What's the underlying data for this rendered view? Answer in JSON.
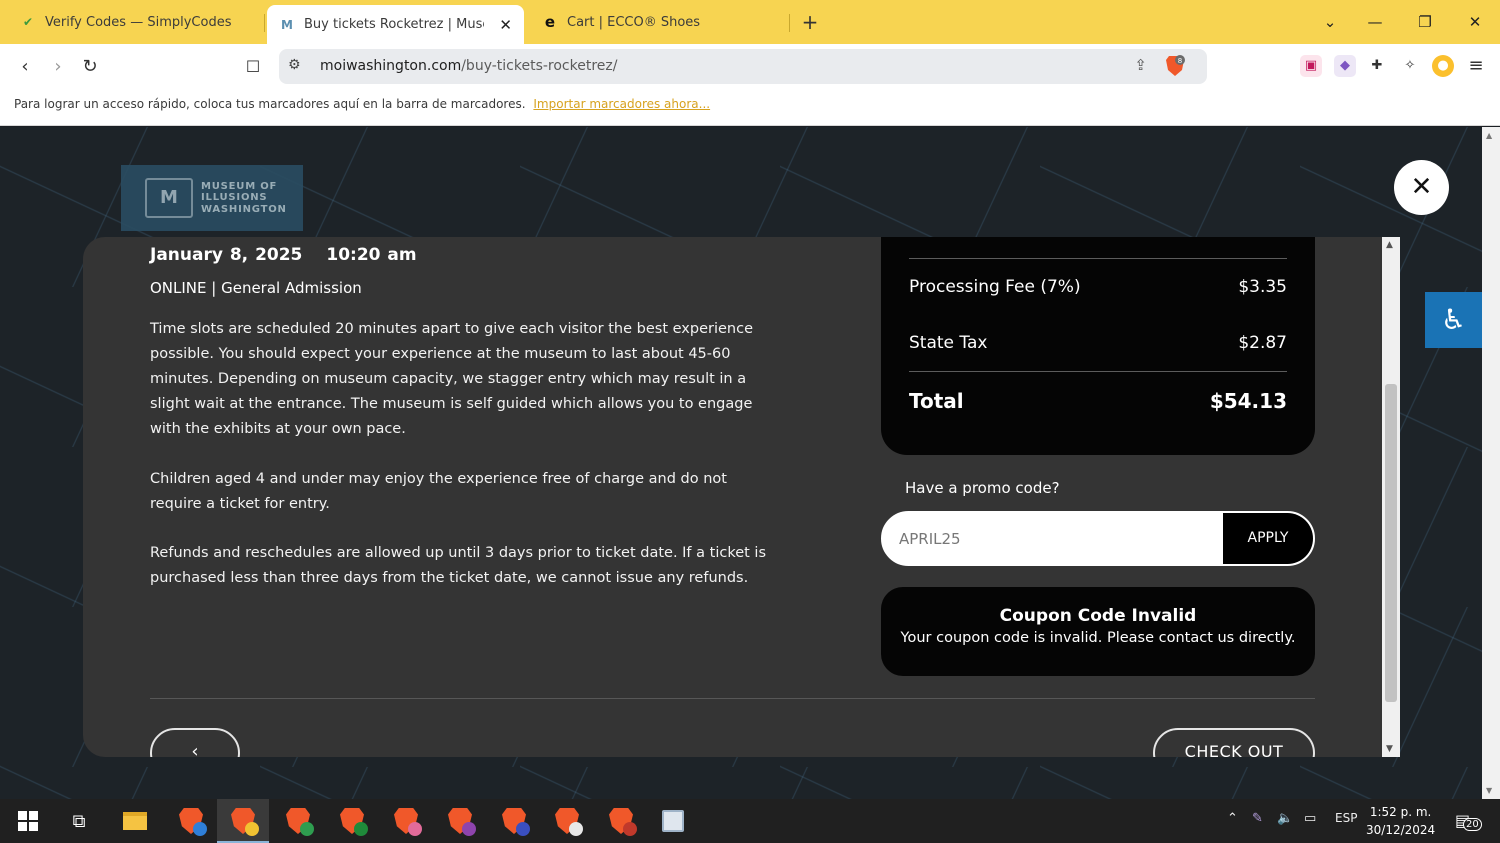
{
  "browser": {
    "tabs": [
      {
        "title": "Verify Codes — SimplyCodes",
        "active": false
      },
      {
        "title": "Buy tickets Rocketrez | Museum",
        "active": true
      },
      {
        "title": "Cart | ECCO® Shoes",
        "active": false
      }
    ],
    "url_domain": "moiwashington.com",
    "url_path": "/buy-tickets-rocketrez/",
    "brave_shield_count": "8",
    "bookmarks_message": "Para lograr un acceso rápido, coloca tus marcadores aquí en la barra de marcadores.",
    "bookmarks_link": "Importar marcadores ahora..."
  },
  "page": {
    "logo_lines": [
      "MUSEUM OF",
      "ILLUSIONS",
      "WASHINGTON"
    ],
    "date": "January 8, 2025",
    "time": "10:20 am",
    "ticket_type": "ONLINE | General Admission",
    "paragraphs": [
      "Time slots are scheduled 20 minutes apart to give each visitor the best experience possible. You should expect your experience at the museum to last about 45-60 minutes. Depending on museum capacity, we stagger entry which may result in a slight wait at the entrance. The museum is self guided which allows you to engage with the exhibits at your own pace.",
      "Children aged 4 and under may enjoy the experience free of charge and do not require a ticket for entry.",
      "Refunds and reschedules are allowed up until 3 days prior to ticket date. If a ticket is purchased less than three days from the ticket date, we cannot issue any refunds."
    ],
    "summary": {
      "processing_fee_label": "Processing Fee (7%)",
      "processing_fee_value": "$3.35",
      "state_tax_label": "State Tax",
      "state_tax_value": "$2.87",
      "total_label": "Total",
      "total_value": "$54.13"
    },
    "promo": {
      "label": "Have a promo code?",
      "value": "APRIL25",
      "apply_label": "APPLY"
    },
    "alert": {
      "title": "Coupon Code Invalid",
      "message": "Your coupon code is invalid. Please contact us directly."
    },
    "back_label": "‹",
    "checkout_label": "CHECK OUT"
  },
  "taskbar": {
    "language": "ESP",
    "time": "1:52 p. m.",
    "date": "30/12/2024",
    "notifications": "20"
  },
  "colors": {
    "tabstrip": "#f7d451",
    "brave": "#f0582a",
    "accessibility": "#1a73b5"
  }
}
